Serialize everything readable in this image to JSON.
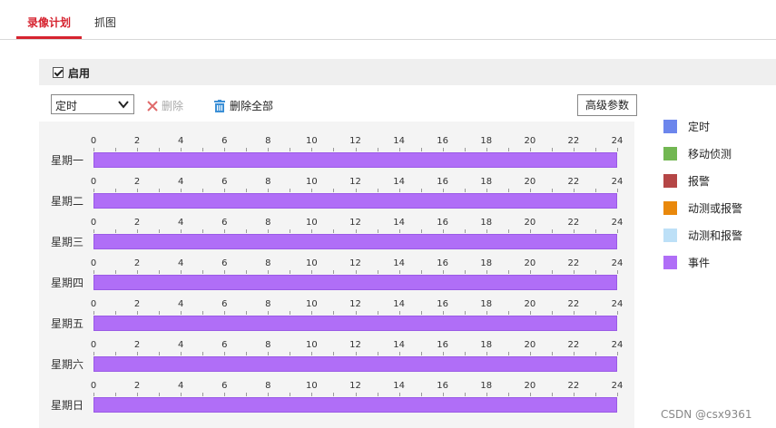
{
  "tabs": [
    {
      "label": "录像计划",
      "active": true
    },
    {
      "label": "抓图",
      "active": false
    }
  ],
  "accent_color": "#d6232f",
  "enable": {
    "label": "启用",
    "checked": true
  },
  "toolbar": {
    "select_value": "定时",
    "delete_label": "删除",
    "delete_all_label": "删除全部",
    "advanced_label": "高级参数"
  },
  "schedule": {
    "hour_labels": [
      "0",
      "2",
      "4",
      "6",
      "8",
      "10",
      "12",
      "14",
      "16",
      "18",
      "20",
      "22",
      "24"
    ],
    "days": [
      {
        "label": "星期一",
        "segments": [
          {
            "start": 0,
            "end": 24,
            "type": "事件"
          }
        ]
      },
      {
        "label": "星期二",
        "segments": [
          {
            "start": 0,
            "end": 24,
            "type": "事件"
          }
        ]
      },
      {
        "label": "星期三",
        "segments": [
          {
            "start": 0,
            "end": 24,
            "type": "事件"
          }
        ]
      },
      {
        "label": "星期四",
        "segments": [
          {
            "start": 0,
            "end": 24,
            "type": "事件"
          }
        ]
      },
      {
        "label": "星期五",
        "segments": [
          {
            "start": 0,
            "end": 24,
            "type": "事件"
          }
        ]
      },
      {
        "label": "星期六",
        "segments": [
          {
            "start": 0,
            "end": 24,
            "type": "事件"
          }
        ]
      },
      {
        "label": "星期日",
        "segments": [
          {
            "start": 0,
            "end": 24,
            "type": "事件"
          }
        ]
      }
    ]
  },
  "legend": [
    {
      "label": "定时",
      "color": "#6c86ec"
    },
    {
      "label": "移动侦测",
      "color": "#72b752"
    },
    {
      "label": "报警",
      "color": "#b54646"
    },
    {
      "label": "动测或报警",
      "color": "#e9880b"
    },
    {
      "label": "动测和报警",
      "color": "#bde0f7"
    },
    {
      "label": "事件",
      "color": "#b06ef7"
    }
  ],
  "watermark": "CSDN @csx9361"
}
